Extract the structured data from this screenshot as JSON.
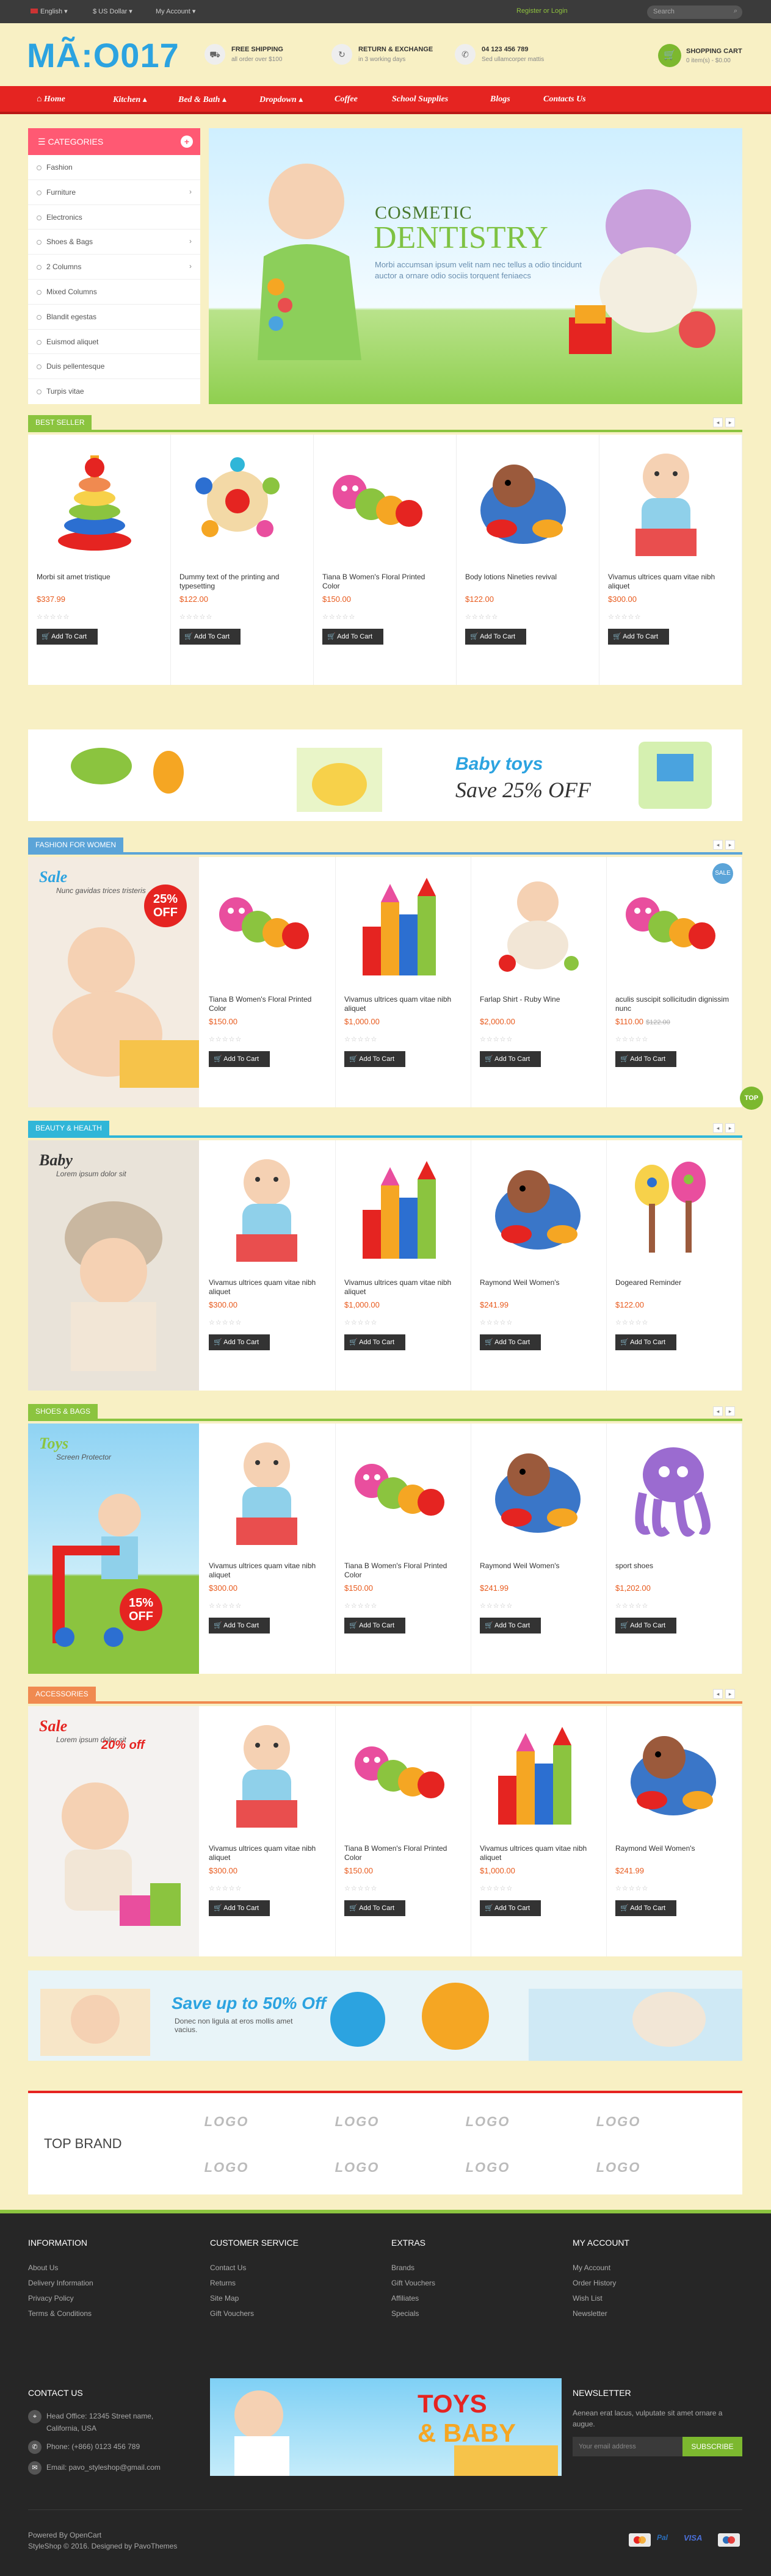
{
  "topbar": {
    "language": "English",
    "currency": "$ US Dollar",
    "account": "My Account",
    "register_login": "Register or Login",
    "search_placeholder": "Search"
  },
  "header": {
    "logo": "MÃ:O017",
    "features": [
      {
        "title": "FREE SHIPPING",
        "sub": "all order over $100"
      },
      {
        "title": "RETURN & EXCHANGE",
        "sub": "in 3 working days"
      },
      {
        "title": "04 123 456 789",
        "sub": "Sed ullamcorper mattis"
      }
    ],
    "cart": {
      "title": "SHOPPING CART",
      "sub": "0 item(s) - $0.00"
    }
  },
  "nav": [
    "Home",
    "Kitchen",
    "Bed & Bath",
    "Dropdown",
    "Coffee",
    "School Supplies",
    "Blogs",
    "Contacts Us"
  ],
  "categories": {
    "title": "CATEGORIES",
    "items": [
      {
        "label": "Fashion",
        "sub": false
      },
      {
        "label": "Furniture",
        "sub": true
      },
      {
        "label": "Electronics",
        "sub": false
      },
      {
        "label": "Shoes & Bags",
        "sub": true
      },
      {
        "label": "2 Columns",
        "sub": true
      },
      {
        "label": "Mixed Columns",
        "sub": false
      },
      {
        "label": "Blandit egestas",
        "sub": false
      },
      {
        "label": "Euismod aliquet",
        "sub": false
      },
      {
        "label": "Duis pellentesque",
        "sub": false
      },
      {
        "label": "Turpis vitae",
        "sub": false
      }
    ]
  },
  "hero": {
    "line1": "COSMETIC",
    "line2": "DENTISTRY",
    "text": "Morbi accumsan ipsum velit nam nec tellus a odio tincidunt auctor a ornare odio sociis torquent feniaecs"
  },
  "sections": {
    "best": {
      "tab": "BEST SELLER",
      "color": "#8bc43f",
      "products": [
        {
          "name": "Morbi sit amet tristique",
          "price": "$337.99"
        },
        {
          "name": "Dummy text of the printing and typesetting",
          "price": "$122.00"
        },
        {
          "name": "Tiana B Women's Floral Printed Color",
          "price": "$150.00"
        },
        {
          "name": "Body lotions Nineties revival",
          "price": "$122.00"
        },
        {
          "name": "Vivamus ultrices quam vitae nibh aliquet",
          "price": "$300.00"
        }
      ]
    },
    "fashion": {
      "tab": "FASHION FOR WOMEN",
      "color": "#5ba4d8",
      "promo_title": "Sale",
      "promo_sub": "Nunc gavidas trices tristeris",
      "badge": "25% OFF",
      "products": [
        {
          "name": "Tiana B Women's Floral Printed Color",
          "price": "$150.00"
        },
        {
          "name": "Vivamus ultrices quam vitae nibh aliquet",
          "price": "$1,000.00"
        },
        {
          "name": "Farlap Shirt - Ruby Wine",
          "price": "$2,000.00"
        },
        {
          "name": "aculis suscipit sollicitudin dignissim nunc",
          "price": "$110.00",
          "old": "$122.00",
          "sale": "SALE"
        }
      ]
    },
    "beauty": {
      "tab": "BEAUTY & HEALTH",
      "color": "#30b6d8",
      "promo_title": "Baby",
      "promo_sub": "Lorem ipsum dolor sit",
      "products": [
        {
          "name": "Vivamus ultrices quam vitae nibh aliquet",
          "price": "$300.00"
        },
        {
          "name": "Vivamus ultrices quam vitae nibh aliquet",
          "price": "$1,000.00"
        },
        {
          "name": "Raymond Weil Women's",
          "price": "$241.99"
        },
        {
          "name": "Dogeared Reminder",
          "price": "$122.00"
        }
      ]
    },
    "shoes": {
      "tab": "SHOES & BAGS",
      "color": "#8bc43f",
      "promo_title": "Toys",
      "promo_sub": "Screen Protector",
      "badge": "15% OFF",
      "products": [
        {
          "name": "Vivamus ultrices quam vitae nibh aliquet",
          "price": "$300.00"
        },
        {
          "name": "Tiana B Women's Floral Printed Color",
          "price": "$150.00"
        },
        {
          "name": "Raymond Weil Women's",
          "price": "$241.99"
        },
        {
          "name": "sport shoes",
          "price": "$1,202.00"
        }
      ]
    },
    "acc": {
      "tab": "ACCESSORIES",
      "color": "#f08a50",
      "promo_title": "Sale",
      "promo_sub": "Lorem ipsum dolor sit",
      "badge": "20% off",
      "products": [
        {
          "name": "Vivamus ultrices quam vitae nibh aliquet",
          "price": "$300.00"
        },
        {
          "name": "Tiana B Women's Floral Printed Color",
          "price": "$150.00"
        },
        {
          "name": "Vivamus ultrices quam vitae nibh aliquet",
          "price": "$1,000.00"
        },
        {
          "name": "Raymond Weil Women's",
          "price": "$241.99"
        }
      ]
    }
  },
  "add_to_cart": "Add To Cart",
  "banner1": {
    "title": "Baby toys",
    "sub": "Save 25% OFF"
  },
  "banner2": {
    "title": "Save up to 50% Off",
    "sub": "Donec non ligula at eros mollis amet vacius."
  },
  "brand": {
    "title": "TOP BRAND",
    "logo": "LOGO"
  },
  "footer": {
    "cols": [
      {
        "title": "INFORMATION",
        "links": [
          "About Us",
          "Delivery Information",
          "Privacy Policy",
          "Terms & Conditions"
        ]
      },
      {
        "title": "CUSTOMER SERVICE",
        "links": [
          "Contact Us",
          "Returns",
          "Site Map",
          "Gift Vouchers"
        ]
      },
      {
        "title": "EXTRAS",
        "links": [
          "Brands",
          "Gift Vouchers",
          "Affiliates",
          "Specials"
        ]
      },
      {
        "title": "MY ACCOUNT",
        "links": [
          "My Account",
          "Order History",
          "Wish List",
          "Newsletter"
        ]
      }
    ],
    "contact": {
      "title": "CONTACT US",
      "address": "Head Office: 12345 Street name, California, USA",
      "phone": "Phone: (+866) 0123 456 789",
      "email": "Email: pavo_styleshop@gmail.com"
    },
    "banner": {
      "line1": "TOYS",
      "line2": "& BABY"
    },
    "newsletter": {
      "title": "NEWSLETTER",
      "text": "Aenean erat lacus, vulputate sit amet ornare a augue.",
      "placeholder": "Your email address",
      "button": "SUBSCRIBE"
    },
    "powered": "Powered By OpenCart",
    "copy": "StyleShop © 2016. Designed by PavoThemes",
    "payments": [
      "mastercard",
      "PayPal",
      "VISA",
      "maestro"
    ]
  },
  "top_button": "TOP"
}
